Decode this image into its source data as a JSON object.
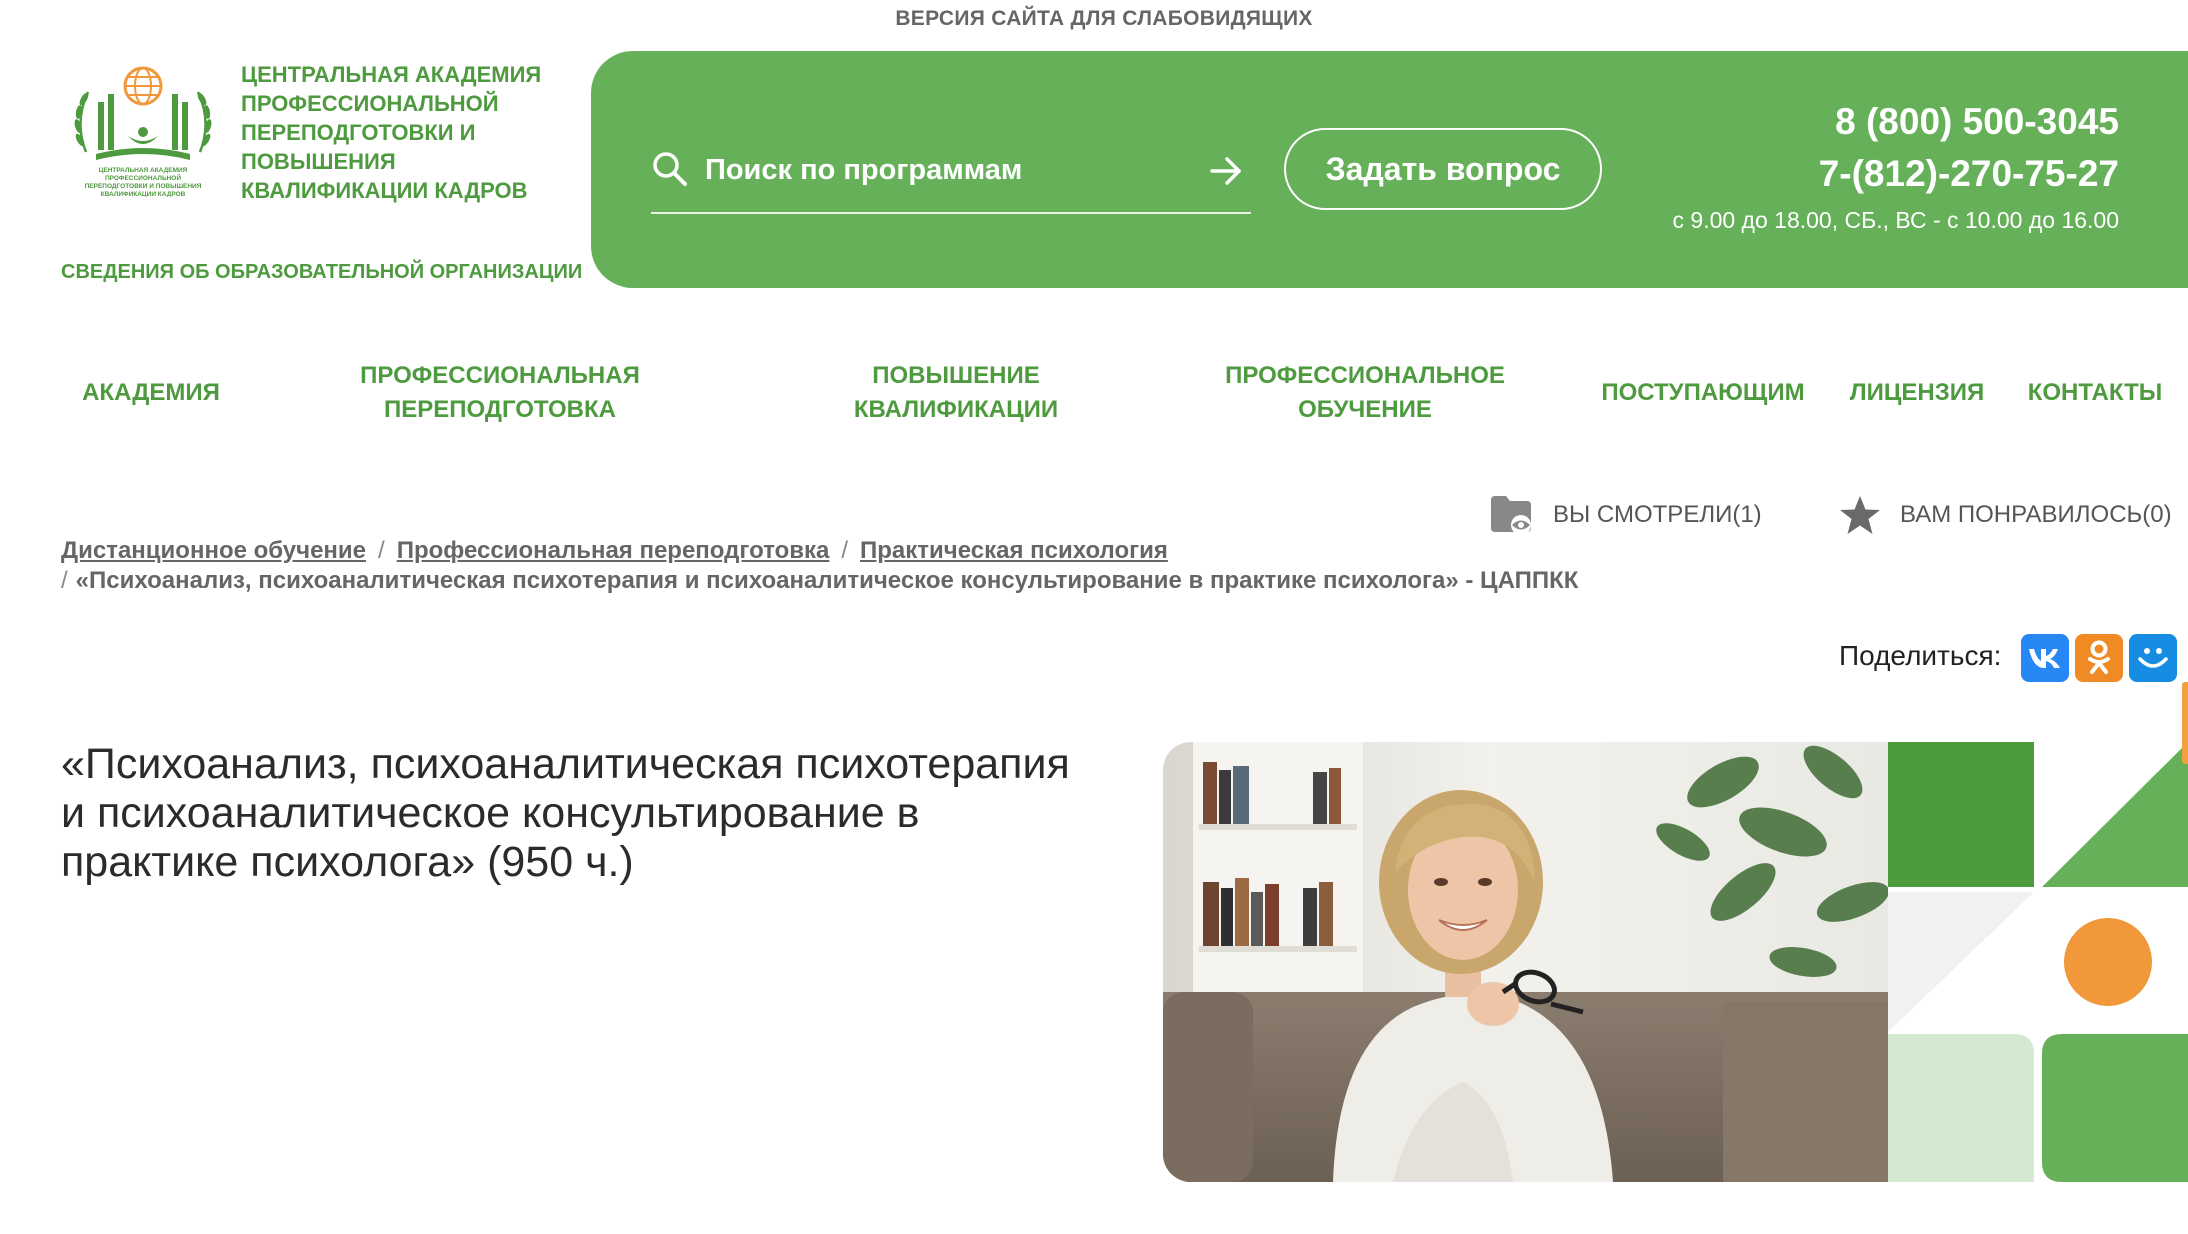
{
  "top_bar": {
    "accessibility_link": "ВЕРСИЯ САЙТА ДЛЯ СЛАБОВИДЯЩИХ"
  },
  "logo": {
    "name": "ЦЕНТРАЛЬНАЯ АКАДЕМИЯ ПРОФЕССИОНАЛЬНОЙ ПЕРЕПОДГОТОВКИ И ПОВЫШЕНИЯ КВАЛИФИКАЦИИ КАДРОВ",
    "emblem_text": "ЦЕНТРАЛЬНАЯ АКАДЕМИЯ ПРОФЕССИОНАЛЬНОЙ ПЕРЕПОДГОТОВКИ И ПОВЫШЕНИЯ КВАЛИФИКАЦИИ КАДРОВ"
  },
  "org_info_link": "СВЕДЕНИЯ ОБ ОБРАЗОВАТЕЛЬНОЙ ОРГАНИЗАЦИИ",
  "header": {
    "search": {
      "placeholder": "Поиск по программам",
      "value": ""
    },
    "ask_button": "Задать вопрос",
    "phone_1": "8 (800) 500-3045",
    "phone_2": "7-(812)-270-75-27",
    "hours": "с 9.00 до 18.00, СБ., ВС - с 10.00 до 16.00"
  },
  "nav": {
    "academy": "АКАДЕМИЯ",
    "retraining": "ПРОФЕССИОНАЛЬНАЯ ПЕРЕПОДГОТОВКА",
    "qualification": "ПОВЫШЕНИЕ КВАЛИФИКАЦИИ",
    "training": "ПРОФЕССИОНАЛЬНОЕ ОБУЧЕНИЕ",
    "applicants": "ПОСТУПАЮЩИМ",
    "license": "ЛИЦЕНЗИЯ",
    "contacts": "КОНТАКТЫ"
  },
  "tools": {
    "viewed": "ВЫ СМОТРЕЛИ(1)",
    "liked": "ВАМ ПОНРАВИЛОСЬ(0)"
  },
  "breadcrumbs": {
    "item_1": "Дистанционное обучение",
    "item_2": "Профессиональная переподготовка",
    "item_3": "Практическая психология",
    "current": "«Психоанализ, психоаналитическая психотерапия и психоаналитическое консультирование в практике психолога» - ЦАППКК",
    "separator": "/"
  },
  "share": {
    "label": "Поделиться:"
  },
  "course": {
    "title": "«Психоанализ, психоаналитическая психотерапия и психоаналитическое консультирование в практике психолога» (950 ч.)"
  },
  "colors": {
    "brand_green": "#66b05a",
    "text_green": "#4e9a3f",
    "dark_green": "#4e9a3f",
    "light_green": "#d4ead0",
    "orange": "#f0983a",
    "vk_blue": "#2787f5",
    "ok_orange": "#f08a24",
    "mailru_blue": "#168de2"
  },
  "icons": {
    "search": "search-icon",
    "arrow": "arrow-right-icon",
    "viewed": "folder-eye-icon",
    "liked": "star-icon",
    "vk": "vk-icon",
    "ok": "odnoklassniki-icon",
    "mail": "mailru-icon"
  }
}
